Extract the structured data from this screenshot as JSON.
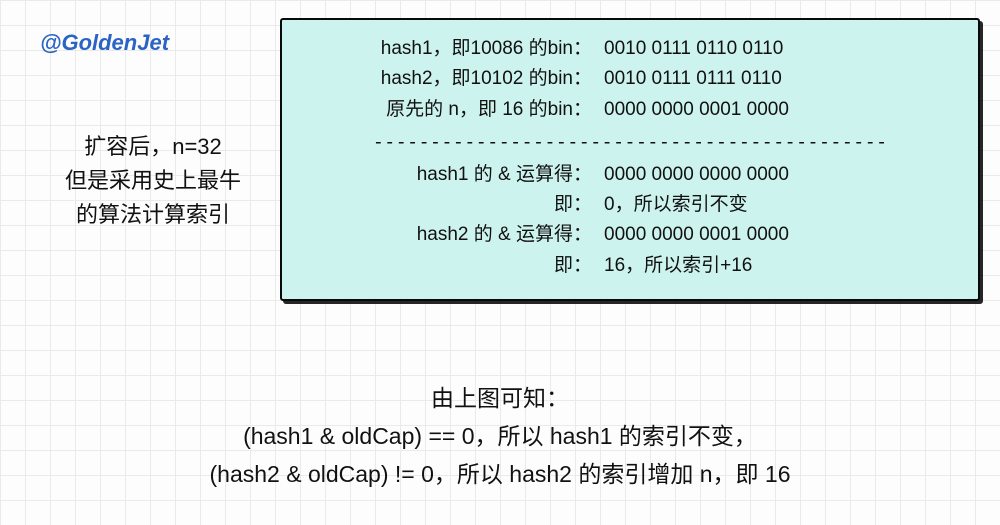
{
  "watermark": "@GoldenJet",
  "left_note": {
    "line1": "扩容后，n=32",
    "line2": "但是采用史上最牛",
    "line3": "的算法计算索引"
  },
  "box": {
    "rows_top": [
      {
        "label": "hash1，即10086 的bin：",
        "value": "0010 0111 0110 0110"
      },
      {
        "label": "hash2，即10102 的bin：",
        "value": "0010 0111 0111 0110"
      },
      {
        "label": "原先的 n，即 16 的bin：",
        "value": "0000 0000 0001 0000"
      }
    ],
    "divider": "---------------------------------------------",
    "rows_bottom": [
      {
        "label": "hash1 的 & 运算得：",
        "value": "0000 0000 0000 0000"
      },
      {
        "label": "即：",
        "value": "0，所以索引不变"
      },
      {
        "label": "hash2 的 & 运算得：",
        "value": "0000 0000 0001 0000"
      },
      {
        "label": "即：",
        "value": "16，所以索引+16"
      }
    ]
  },
  "bottom": {
    "line1": "由上图可知：",
    "line2": "(hash1 & oldCap) == 0，所以 hash1 的索引不变，",
    "line3": "(hash2 & oldCap) != 0，所以 hash2 的索引增加 n，即 16"
  }
}
